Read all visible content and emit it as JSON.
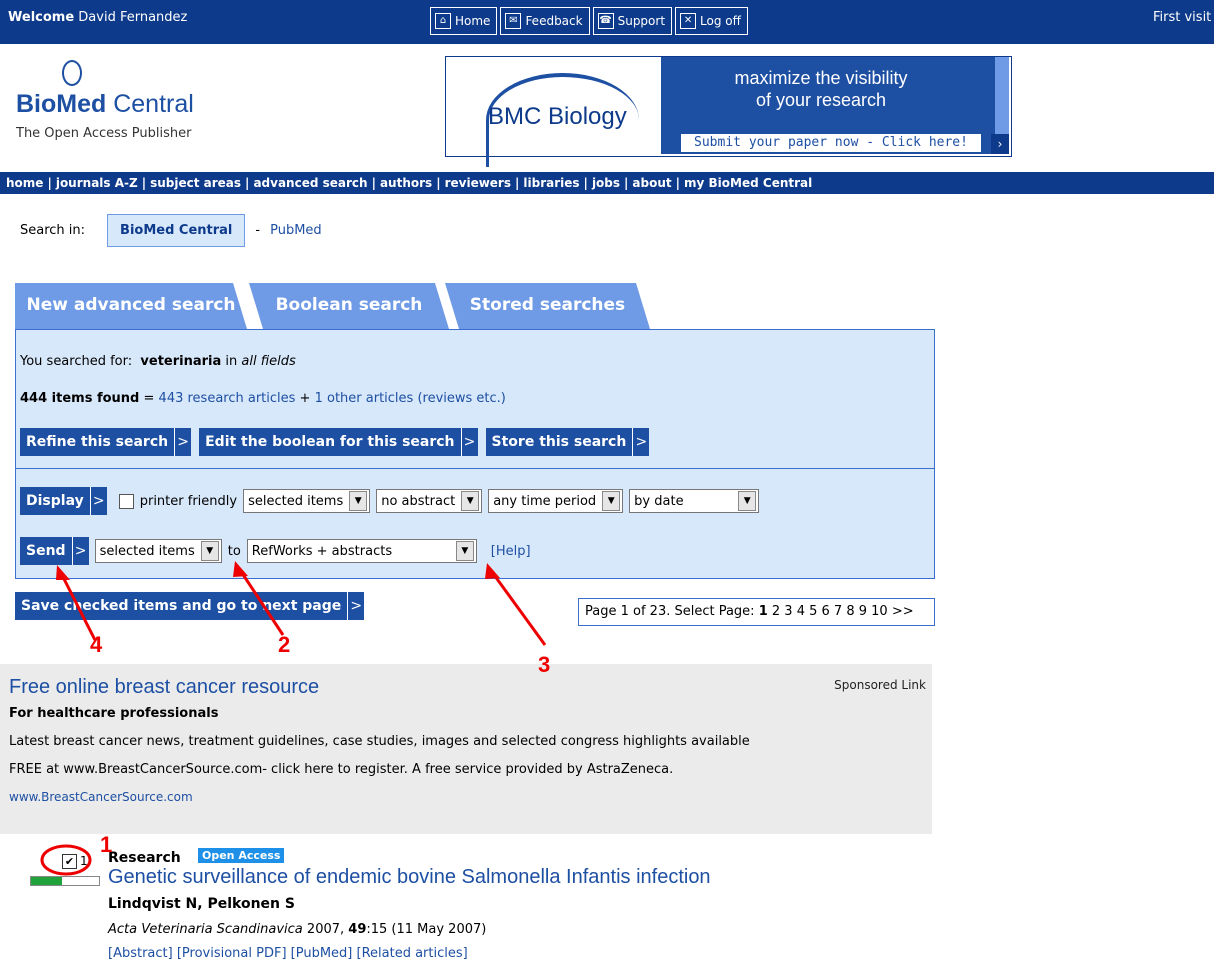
{
  "topbar": {
    "welcome_label": "Welcome",
    "user_name": "David Fernandez",
    "buttons": [
      {
        "label": "Home",
        "icon": "home-icon"
      },
      {
        "label": "Feedback",
        "icon": "feedback-icon"
      },
      {
        "label": "Support",
        "icon": "support-icon"
      },
      {
        "label": "Log off",
        "icon": "logoff-icon"
      }
    ],
    "first_visit": "First visit"
  },
  "logo": {
    "name_bold": "BioMed",
    "name_rest": " Central",
    "tagline": "The Open Access Publisher"
  },
  "banner": {
    "journal": "BMC Biology",
    "line1": "maximize the visibility",
    "line2": "of your research",
    "cta": "Submit your paper now - Click here!"
  },
  "nav": {
    "items": [
      "home",
      "journals A-Z",
      "subject areas",
      "advanced search",
      "authors",
      "reviewers",
      "libraries",
      "jobs",
      "about",
      "my BioMed Central"
    ]
  },
  "search_in": {
    "label": "Search in:",
    "active": "BioMed Central",
    "separator": "-",
    "other": "PubMed"
  },
  "tabs": [
    "New advanced search",
    "Boolean search",
    "Stored searches"
  ],
  "results": {
    "you_searched_label": "You searched for:",
    "term": "veterinaria",
    "in_label": "in",
    "field": "all fields",
    "count_label": "444 items found",
    "equals": " = ",
    "research_link": "443 research articles",
    "plus": " + ",
    "other_link": "1 other articles (reviews etc.)",
    "buttons": [
      "Refine this search",
      "Edit the boolean for this search",
      "Store this search"
    ]
  },
  "display_row": {
    "button": "Display",
    "printer_friendly": "printer friendly",
    "selects": [
      "selected items",
      "no abstract",
      "any time period",
      "by date"
    ]
  },
  "send_row": {
    "button": "Send",
    "select_items": "selected items",
    "to": "to",
    "select_format": "RefWorks + abstracts",
    "help": "[Help]"
  },
  "save_button": "Save checked items and go to next page",
  "pager": {
    "prefix": "Page 1 of 23. Select Page:",
    "current": "1",
    "pages": "2 3 4 5 6 7 8 9 10",
    "next": ">>"
  },
  "sponsor": {
    "title": "Free online breast cancer resource",
    "label": "Sponsored Link",
    "subtitle": "For healthcare professionals",
    "line1": "Latest breast cancer news, treatment guidelines, case studies, images and selected congress highlights available",
    "line2": "FREE at www.BreastCancerSource.com- click here to register. A free service provided by AstraZeneca.",
    "url": "www.BreastCancerSource.com"
  },
  "article": {
    "number": "1.",
    "category": "Research",
    "badge": "Open Access",
    "title": "Genetic surveillance of endemic bovine Salmonella Infantis infection",
    "authors": "Lindqvist N, Pelkonen S",
    "journal": "Acta Veterinaria Scandinavica",
    "year": "2007,",
    "volume": "49",
    "issue": ":15 (11 May 2007)",
    "links": "[Abstract] [Provisional PDF] [PubMed] [Related articles]",
    "checked": true,
    "relevance_fraction": 0.45
  },
  "annotations": [
    "1",
    "2",
    "3",
    "4"
  ],
  "colors": {
    "navy": "#0d3a8a",
    "blue": "#1d4fa3",
    "panel": "#d8e8fb",
    "tab": "#6e9ae6",
    "annotation": "#e00000"
  }
}
